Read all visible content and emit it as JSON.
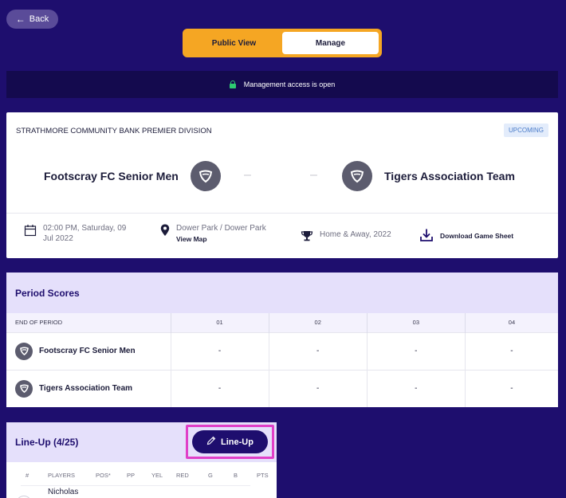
{
  "header": {
    "back_label": "Back"
  },
  "view_toggle": {
    "public_label": "Public View",
    "manage_label": "Manage",
    "active": "Manage"
  },
  "access": {
    "message": "Management access is open"
  },
  "match": {
    "division": "STRATHMORE COMMUNITY BANK PREMIER DIVISION",
    "status": "UPCOMING",
    "home_team": "Footscray FC Senior Men",
    "away_team": "Tigers Association Team",
    "home_score": "–",
    "away_score": "–",
    "date_line1": "02:00 PM, Saturday, 09",
    "date_line2": "Jul 2022",
    "venue": "Dower Park / Dower Park",
    "view_map_label": "View Map",
    "competition": "Home & Away, 2022",
    "download_label": "Download Game Sheet"
  },
  "period_scores": {
    "title": "Period Scores",
    "columns": [
      "END OF PERIOD",
      "01",
      "02",
      "03",
      "04"
    ],
    "rows": [
      {
        "team": "Footscray FC Senior Men",
        "scores": [
          "-",
          "-",
          "-",
          "-"
        ]
      },
      {
        "team": "Tigers Association Team",
        "scores": [
          "-",
          "-",
          "-",
          "-"
        ]
      }
    ]
  },
  "lineup": {
    "title": "Line-Up (4/25)",
    "button_label": "Line-Up",
    "columns": [
      "#",
      "PLAYERS",
      "POS*",
      "PP",
      "YEL",
      "RED",
      "G",
      "B",
      "PTS"
    ],
    "first_player": "Nicholas"
  },
  "colors": {
    "background": "#1e0e6e",
    "accent": "#f5a623",
    "highlight": "#e040c8",
    "lock": "#2ecc71"
  }
}
